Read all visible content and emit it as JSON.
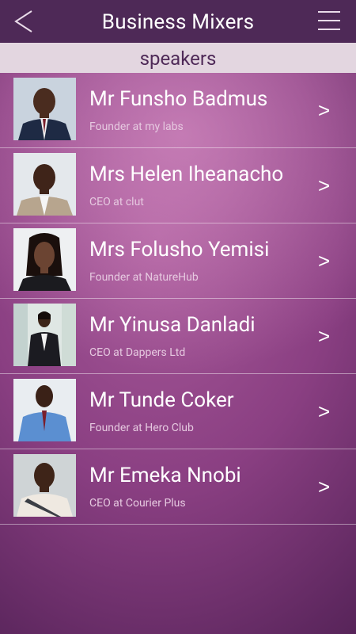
{
  "header": {
    "title": "Business Mixers",
    "back_icon": "back-chevron-icon",
    "menu_icon": "hamburger-menu-icon"
  },
  "subheader": {
    "label": "speakers"
  },
  "speakers": [
    {
      "name": "Mr Funsho Badmus",
      "role": "Founder at my labs",
      "arrow": ">"
    },
    {
      "name": "Mrs Helen Iheanacho",
      "role": "CEO at clut",
      "arrow": ">"
    },
    {
      "name": "Mrs Folusho Yemisi",
      "role": "Founder at NatureHub",
      "arrow": ">"
    },
    {
      "name": "Mr Yinusa Danladi",
      "role": "CEO at Dappers Ltd",
      "arrow": ">"
    },
    {
      "name": "Mr Tunde Coker",
      "role": "Founder at Hero Club",
      "arrow": ">"
    },
    {
      "name": "Mr Emeka Nnobi",
      "role": "CEO at Courier Plus",
      "arrow": ">"
    }
  ],
  "colors": {
    "header_bg": "#4e2957",
    "subheader_bg": "#e3d6e0",
    "subheader_text": "#4f2a58",
    "role_text": "#e6c9e0"
  }
}
